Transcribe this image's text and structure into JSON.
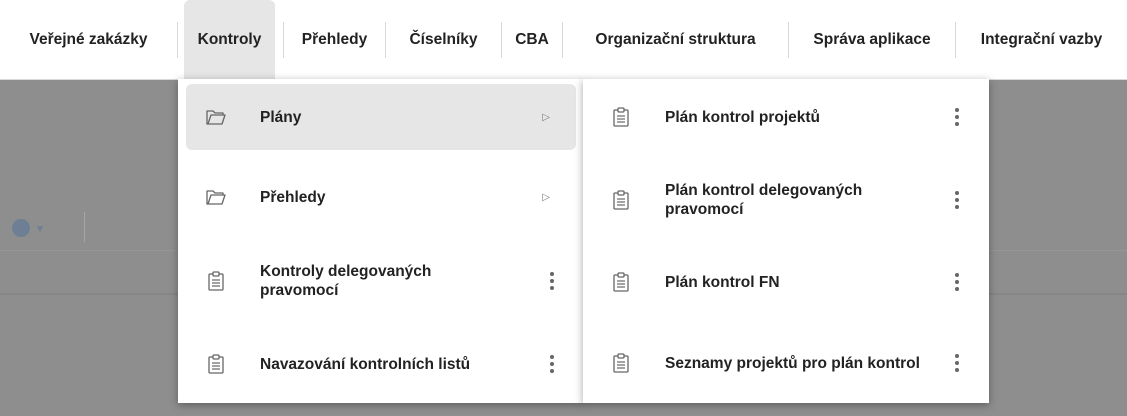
{
  "nav": {
    "items": [
      {
        "label": "Veřejné zakázky"
      },
      {
        "label": "Kontroly"
      },
      {
        "label": "Přehledy"
      },
      {
        "label": "Číselníky"
      },
      {
        "label": "CBA"
      },
      {
        "label": "Organizační struktura"
      },
      {
        "label": "Správa aplikace"
      },
      {
        "label": "Integrační vazby"
      }
    ],
    "active": "Kontroly"
  },
  "submenu": {
    "items": [
      {
        "label": "Plány",
        "icon": "folder-icon",
        "has_submenu": true,
        "highlighted": true
      },
      {
        "label": "Přehledy",
        "icon": "folder-icon",
        "has_submenu": true
      },
      {
        "label": "Kontroly delegovaných pravomocí",
        "icon": "clipboard-icon",
        "has_actions": true
      },
      {
        "label": "Navazování kontrolních listů",
        "icon": "clipboard-icon",
        "has_actions": true
      }
    ]
  },
  "plany_menu": {
    "items": [
      {
        "label": "Plán kontrol projektů",
        "icon": "clipboard-icon"
      },
      {
        "label": "Plán kontrol delegovaných pravomocí",
        "icon": "clipboard-icon"
      },
      {
        "label": "Plán kontrol FN",
        "icon": "clipboard-icon"
      },
      {
        "label": "Seznamy projektů pro plán kontrol",
        "icon": "clipboard-icon"
      }
    ]
  }
}
